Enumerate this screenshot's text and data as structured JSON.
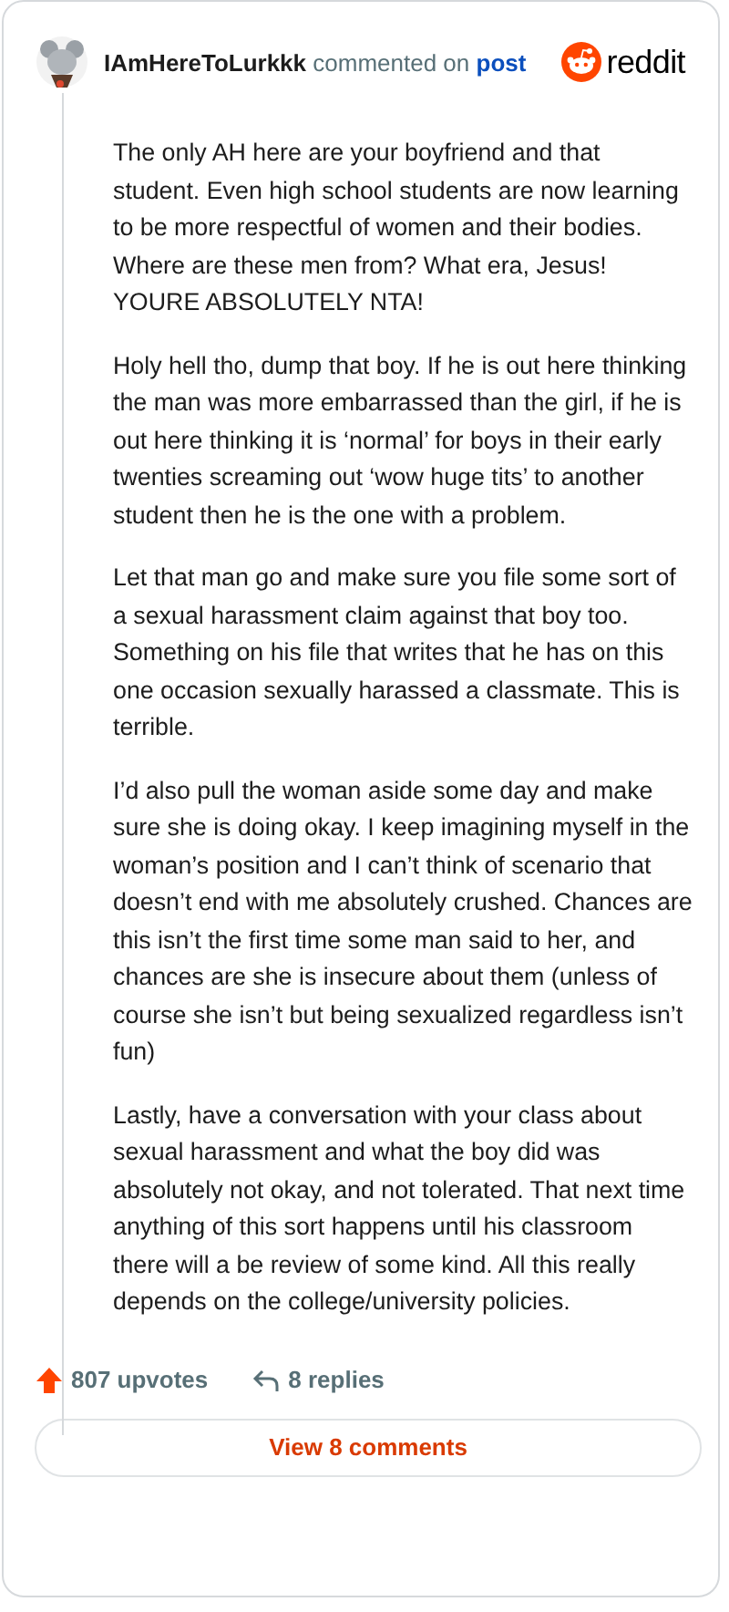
{
  "header": {
    "username": "IAmHereToLurkkk",
    "action": "commented on",
    "link": "post",
    "brand": "reddit"
  },
  "paragraphs": [
    "The only AH here are your boyfriend and that student. Even high school students are now learning to be more respectful of women and their bodies. Where are these men from? What era, Jesus! YOURE ABSOLUTELY NTA!",
    "Holy hell tho, dump that boy. If he is out here thinking the man was more embarrassed than the girl, if he is out here thinking it is ‘normal’ for boys in their early twenties screaming out ‘wow huge tits’ to another student then he is the one with a problem.",
    "Let that man go and make sure you file some sort of a sexual harassment claim against that boy too. Something on his file that writes that he has on this one occasion sexually harassed a classmate. This is terrible.",
    "I’d also pull the woman aside some day and make sure she is doing okay. I keep imagining myself in the woman’s position and I can’t think of scenario that doesn’t end with me absolutely crushed. Chances are this isn’t the first time some man said to her, and chances are she is insecure about them (unless of course she isn’t but being sexualized regardless isn’t fun)",
    "Lastly, have a conversation with your class about sexual harassment and what the boy did was absolutely not okay, and not tolerated. That next time anything of this sort happens until his classroom there will a be review of some kind. All this really depends on the college/university policies."
  ],
  "footer": {
    "upvotes": "807 upvotes",
    "replies": "8 replies"
  },
  "view_button": "View 8 comments"
}
